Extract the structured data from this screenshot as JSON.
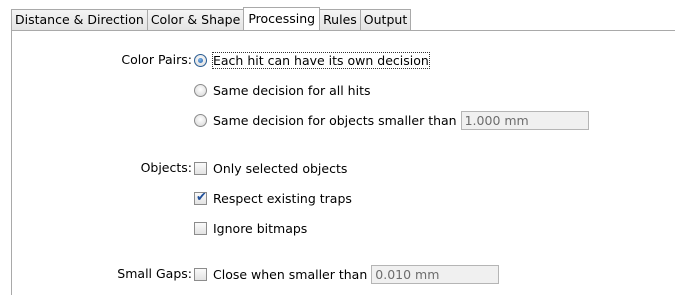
{
  "tabs": [
    {
      "label": "Distance & Direction"
    },
    {
      "label": "Color & Shape"
    },
    {
      "label": "Processing",
      "active": true
    },
    {
      "label": "Rules"
    },
    {
      "label": "Output"
    }
  ],
  "color_pairs": {
    "label": "Color Pairs:",
    "options": [
      {
        "label": "Each hit can have its own decision",
        "selected": true
      },
      {
        "label": "Same decision for all hits",
        "selected": false
      },
      {
        "label": "Same decision for objects smaller than",
        "selected": false
      }
    ],
    "size_value": "1.000 mm"
  },
  "objects": {
    "label": "Objects:",
    "options": [
      {
        "label": "Only selected objects",
        "checked": false
      },
      {
        "label": "Respect existing traps",
        "checked": true
      },
      {
        "label": "Ignore bitmaps",
        "checked": false
      }
    ]
  },
  "small_gaps": {
    "label": "Small Gaps:",
    "option": {
      "label": "Close when smaller than",
      "checked": false
    },
    "value": "0.010 mm"
  },
  "icons": {
    "checkmark": "✔"
  }
}
